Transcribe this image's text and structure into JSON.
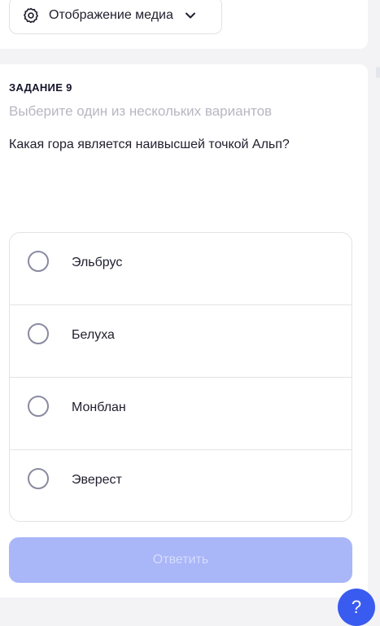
{
  "media": {
    "label": "Отображение медиа"
  },
  "task": {
    "number": "ЗАДАНИЕ 9",
    "hint": "Выберите один из нескольких вариантов",
    "question": "Какая гора является наивысшей точкой Альп?",
    "options": [
      {
        "label": "Эльбрус"
      },
      {
        "label": "Белуха"
      },
      {
        "label": "Монблан"
      },
      {
        "label": "Эверест"
      }
    ],
    "submit_label": "Ответить"
  },
  "help": {
    "label": "?"
  },
  "colors": {
    "accent": "#3a5bf0",
    "button_disabled": "#a9b6f8",
    "hint": "#b7b7c3",
    "border": "#e3e3e8"
  }
}
